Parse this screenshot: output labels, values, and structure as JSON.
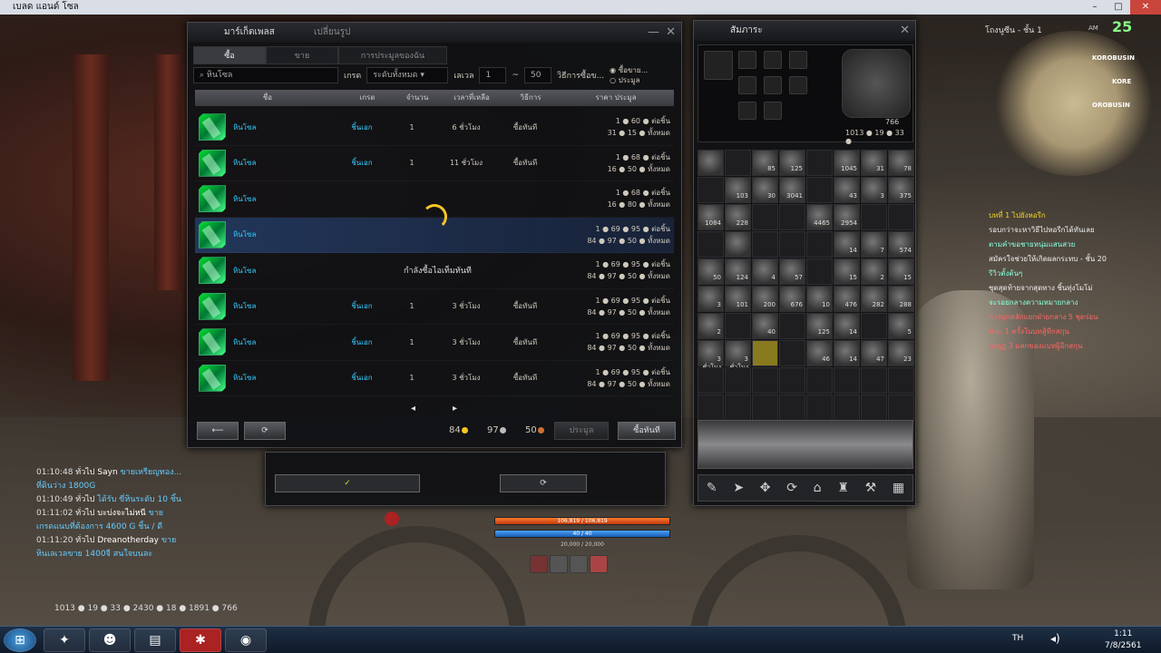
{
  "window": {
    "title": "เบลด แอนด์ โซล"
  },
  "market": {
    "title": "มาร์เก็ตเพลส",
    "title2": "เปลี่ยนรูป",
    "tabs": [
      "ซื้อ",
      "ขาย",
      "การประมูลของฉัน"
    ],
    "search_value": "หินโซล",
    "grade_label": "เกรด",
    "grade_value": "ระดับทั้งหมด",
    "level_label": "เลเวล",
    "level_from": "1",
    "level_to": "50",
    "buy_method_label": "วิธีการซื้อข...",
    "opt_buy": "ซื้อขาย...",
    "opt_auction": "ประมูล",
    "columns": [
      "ชื่อ",
      "เกรด",
      "จำนวน",
      "เวลาที่เหลือ",
      "วิธีการ",
      "ราคา ประมูล"
    ],
    "rows": [
      {
        "name": "หินโซล",
        "cat": "ชิ้นเอก",
        "qty": "1",
        "time": "6 ชั่วโมง",
        "method": "ซื้อทันที",
        "p1": "1 ● 60 ● ต่อชิ้น",
        "p2": "31 ● 15 ● ทั้งหมด",
        "count": "12"
      },
      {
        "name": "หินโซล",
        "cat": "ชิ้นเอก",
        "qty": "1",
        "time": "11 ชั่วโมง",
        "method": "ซื้อทันที",
        "p1": "1 ● 68 ● ต่อชิ้น",
        "p2": "16 ● 50 ● ทั้งหมด",
        "count": "10"
      },
      {
        "name": "หินโซล",
        "cat": "",
        "qty": "",
        "time": "",
        "method": "",
        "p1": "1 ● 68 ● ต่อชิ้น",
        "p2": "16 ● 80 ● ทั้งหมด",
        "count": "10"
      },
      {
        "name": "หินโซล",
        "cat": "",
        "qty": "",
        "time": "",
        "method": "",
        "p1": "1 ● 69 ● 95 ● ต่อชิ้น",
        "p2": "84 ● 97 ● 50 ● ทั้งหมด",
        "count": "50"
      },
      {
        "name": "หินโซล",
        "cat": "",
        "qty": "",
        "time": "",
        "method": "",
        "p1": "1 ● 69 ● 95 ● ต่อชิ้น",
        "p2": "84 ● 97 ● 50 ● ทั้งหมด",
        "count": "50"
      },
      {
        "name": "หินโซล",
        "cat": "ชิ้นเอก",
        "qty": "1",
        "time": "3 ชั่วโมง",
        "method": "ซื้อทันที",
        "p1": "1 ● 69 ● 95 ● ต่อชิ้น",
        "p2": "84 ● 97 ● 50 ● ทั้งหมด",
        "count": "50"
      },
      {
        "name": "หินโซล",
        "cat": "ชิ้นเอก",
        "qty": "1",
        "time": "3 ชั่วโมง",
        "method": "ซื้อทันที",
        "p1": "1 ● 69 ● 95 ● ต่อชิ้น",
        "p2": "84 ● 97 ● 50 ● ทั้งหมด",
        "count": "50"
      },
      {
        "name": "หินโซล",
        "cat": "ชิ้นเอก",
        "qty": "1",
        "time": "3 ชั่วโมง",
        "method": "ซื้อทันที",
        "p1": "1 ● 69 ● 95 ● ต่อชิ้น",
        "p2": "84 ● 97 ● 50 ● ทั้งหมด",
        "count": "50"
      }
    ],
    "loading_text": "กำลังซื้อไอเท็มทันที",
    "total_gold": "84",
    "total_silver": "97",
    "total_copper": "50",
    "bid_label": "ประมูล",
    "buy_now_label": "ซื้อทันที",
    "back_icon": "arrow-left",
    "refresh_icon": "refresh"
  },
  "inventory": {
    "title": "สัมภาระ",
    "money": "1013 ● 19 ● 33 ●",
    "money_small": "766",
    "cells": [
      "",
      "",
      "85",
      "125",
      "",
      "1045",
      "31",
      "78",
      "",
      "103",
      "30",
      "3041",
      "",
      "43",
      "3",
      "375",
      "1084",
      "228",
      "",
      "",
      "4465",
      "2954",
      "",
      "",
      "",
      "",
      "",
      "",
      "",
      "14",
      "7",
      "574",
      "50",
      "124",
      "4",
      "57",
      "",
      "15",
      "2",
      "15",
      "3",
      "101",
      "200",
      "676",
      "10",
      "476",
      "282",
      "288",
      "2",
      "",
      "40",
      "",
      "125",
      "14",
      "",
      "5",
      "3 ชั่วโมง",
      "3 ชั่วโมง",
      "",
      "",
      "46",
      "14",
      "47",
      "23"
    ]
  },
  "chat": [
    {
      "time": "01:10:48",
      "ch": "ทั่วไป",
      "user": "Sayn",
      "text": "ขายเหรียญทอง..."
    },
    {
      "time": "",
      "ch": "",
      "user": "",
      "text": "ที่ดินว่าง 1800G"
    },
    {
      "time": "01:10:49",
      "ch": "ทั่วไป",
      "user": "",
      "text": "ได้รับ ขี่หินระดับ 10 ชิ้น"
    },
    {
      "time": "01:11:02",
      "ch": "ทั่วไป",
      "user": "บะบ่งจะไม่หนี",
      "text": "ขาย"
    },
    {
      "time": "",
      "ch": "",
      "user": "",
      "text": "เกรดแนบที่ต้องการ 4600 G ชิ้น / ดี"
    },
    {
      "time": "01:11:20",
      "ch": "ทั่วไป",
      "user": "Dreanotherday",
      "text": "ขาย"
    },
    {
      "time": "",
      "ch": "",
      "user": "",
      "text": "หินเลเวลขาย 1400จี สนใจบนละ"
    }
  ],
  "minimap": {
    "title": "โถงนูซีน - ชั้น 1",
    "label1": "KOROBUSIN",
    "label2": "KORE",
    "label3": "OROBUSIN",
    "time": "AM",
    "clock": "25"
  },
  "quest": [
    {
      "cls": "qh",
      "text": "บทที่ 1 ไปยังหอรีก"
    },
    {
      "cls": "",
      "text": "รอบกว่าจะหาวิธีไปหอรีกได้ทันเลย"
    },
    {
      "cls": "qb",
      "text": "ตามคำขอชายหนุ่มแสนสวย"
    },
    {
      "cls": "",
      "text": "สมัครใจช่วยให้เกิดผลกระทบ - ชั้น 20"
    },
    {
      "cls": "qb",
      "text": "รีวิวตั้งต้นๆ"
    },
    {
      "cls": "",
      "text": "ชุดสุดท้ายจากสุดทาง ชิ้นทุ่งโมโม่"
    },
    {
      "cls": "qb",
      "text": "จะรอยกลางความหมายกลาง"
    },
    {
      "cls": "qr",
      "text": "การบุกหลักแยกฝ่ายกลาง 5 ชุดร่อน"
    },
    {
      "cls": "qr",
      "text": "ขนะ 1 ครั้งในบทสู้ทีกสกุน"
    },
    {
      "cls": "qr",
      "text": "บงกูฏ 3 แลกของแบทฝู้อีกสกุน"
    }
  ],
  "hud": {
    "hp": "106,819 / 106,819",
    "hp_pct": 1.0,
    "chi": "40 / 40",
    "focus": "20,000 / 20,000",
    "resources": "1013 ● 19 ● 33 ● 2430 ● 18 ● 1891 ● 766"
  },
  "taskbar": {
    "clock": "1:11",
    "date": "7/8/2561",
    "lang": "TH"
  }
}
